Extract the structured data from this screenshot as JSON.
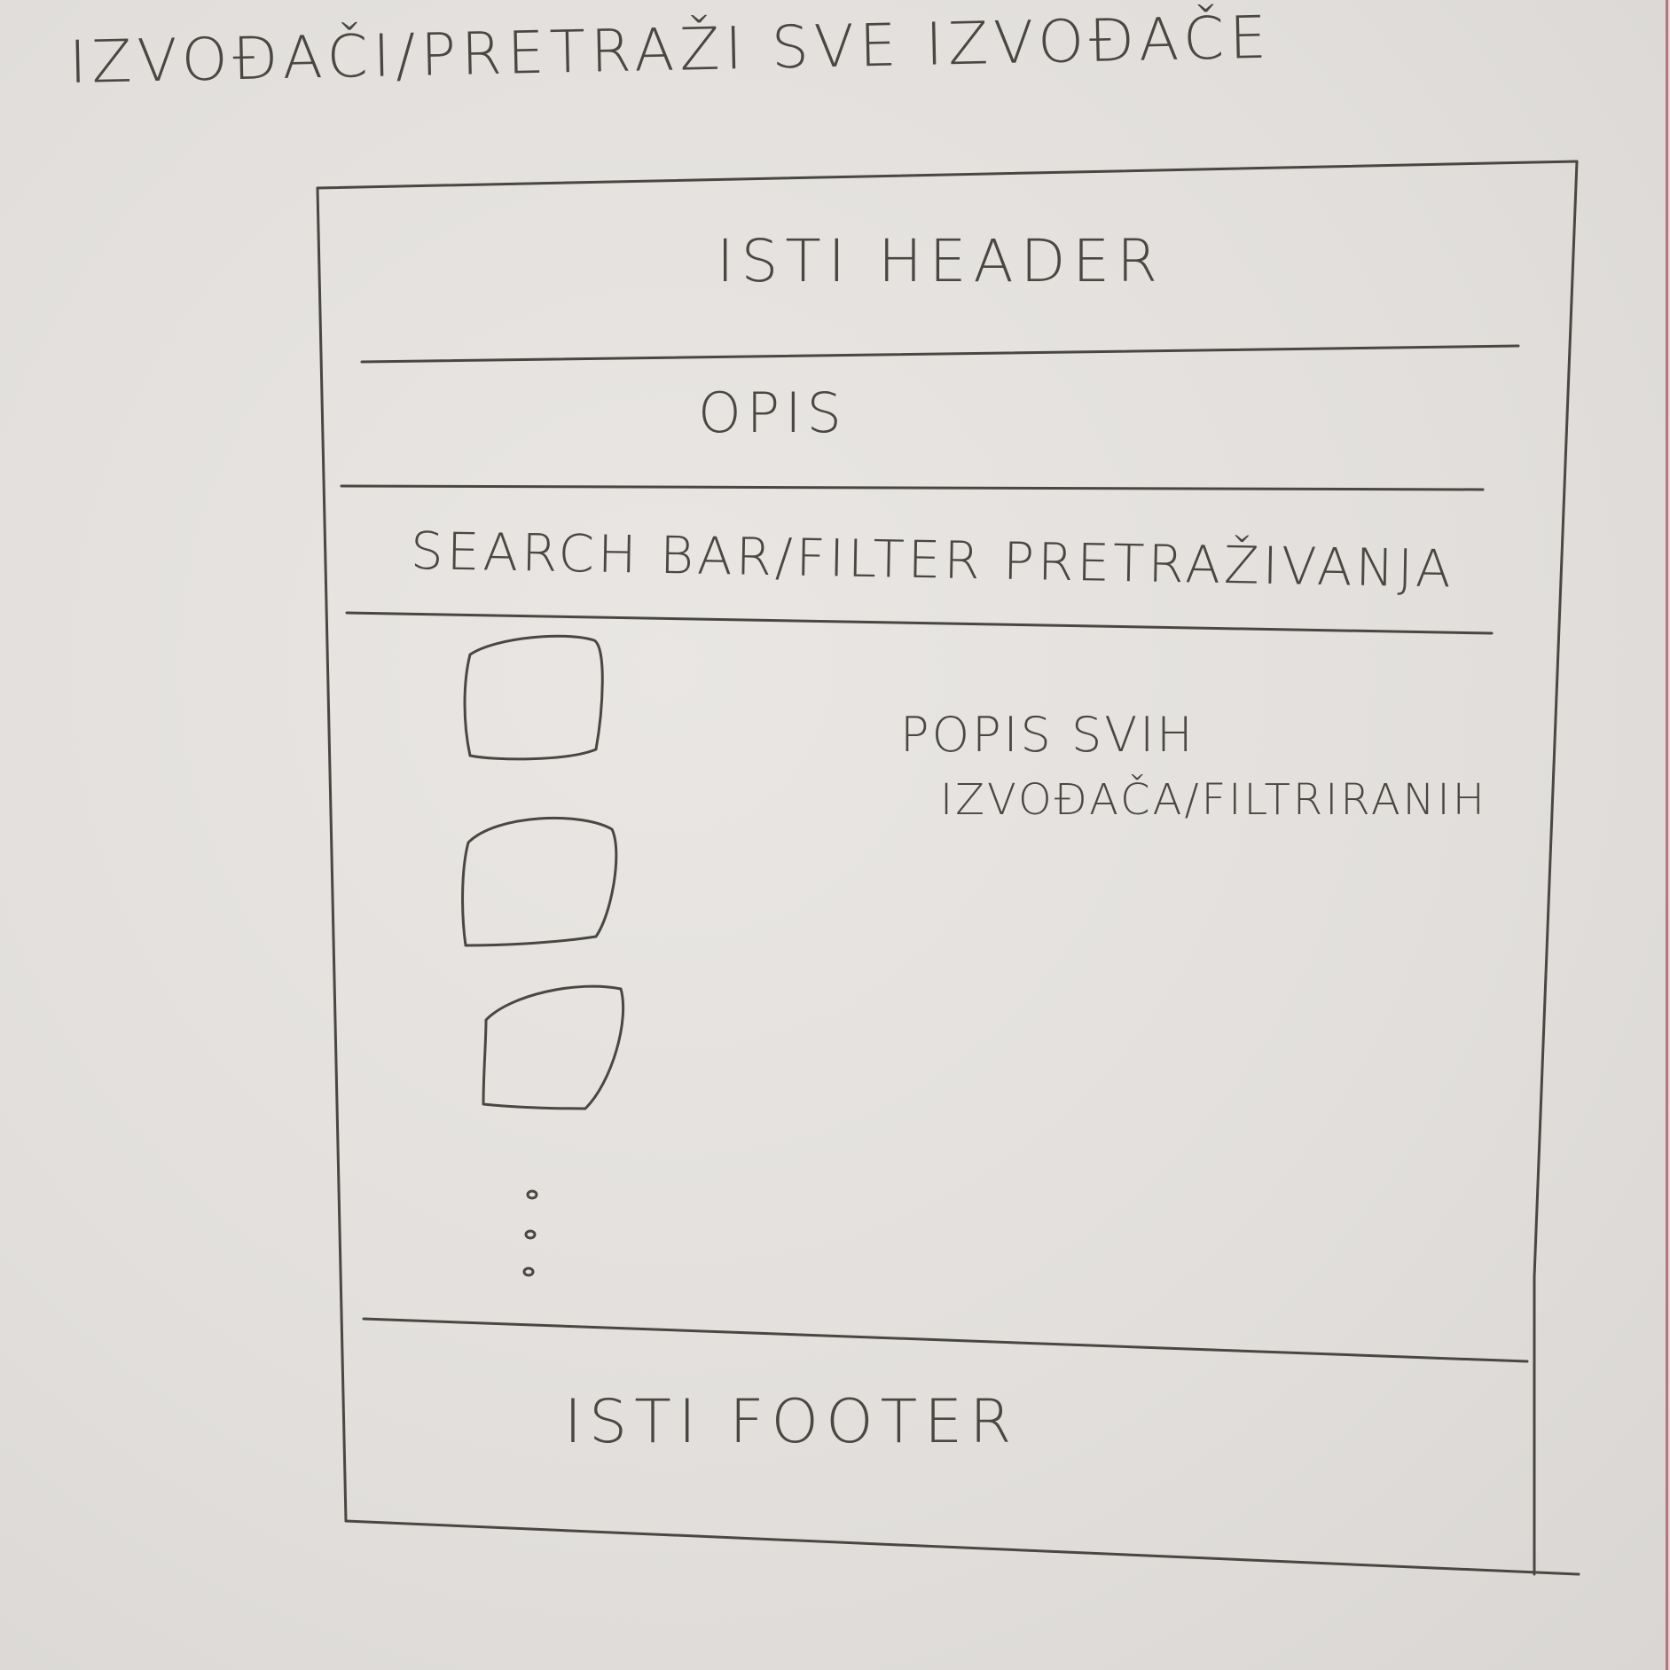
{
  "sketch": {
    "title": "IZVOĐAČI/PRETRAŽI SVE IZVOĐAČE",
    "sections": {
      "header": "ISTI HEADER",
      "description": "OPIS",
      "search": "SEARCH BAR/FILTER PRETRAŽIVANJA",
      "list_line1": "POPIS SVIH",
      "list_line2": "IZVOĐAČA/FILTRIRANIH",
      "footer": "ISTI FOOTER"
    },
    "list_items": [
      "item-1",
      "item-2",
      "item-3"
    ],
    "more_indicator": "ellipsis-vertical-icon"
  },
  "colors": {
    "paper": "#e4e1de",
    "pencil": "#4a4642",
    "edge": "#a8545a"
  }
}
